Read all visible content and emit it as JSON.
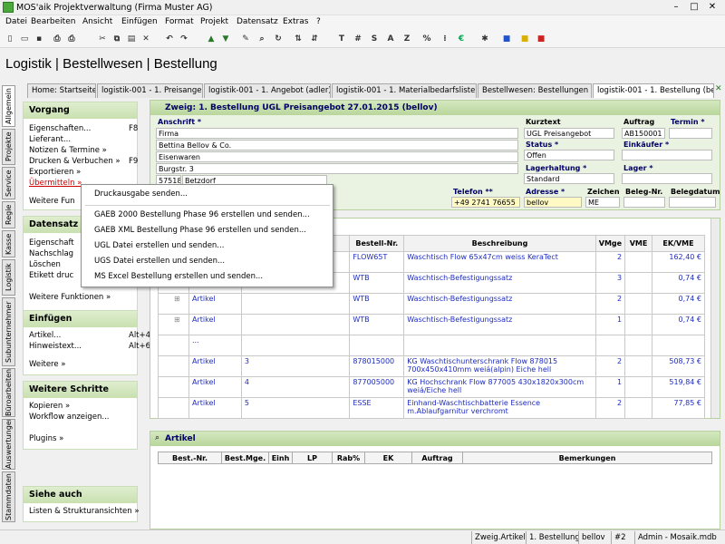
{
  "window": {
    "title": "MOS'aik Projektverwaltung (Firma Muster AG)"
  },
  "menu": [
    "Datei",
    "Bearbeiten",
    "Ansicht",
    "Einfügen",
    "Format",
    "Projekt",
    "Datensatz",
    "Extras",
    "?"
  ],
  "toolbar": {
    "letters": [
      "T",
      "#",
      "S",
      "A",
      "Z",
      "%"
    ]
  },
  "page_title": "Logistik | Bestellwesen | Bestellung",
  "tabs": [
    "Home: Startseite",
    "logistik-001 - 1. Preisangebot",
    "logistik-001 - 1. Angebot (adler)",
    "logistik-001 - 1. Materialbedarfsliste (adler)",
    "Bestellwesen: Bestellungen",
    "logistik-001 - 1. Bestellung (bellov)"
  ],
  "vtabs": [
    "Allgemein",
    "Projekte",
    "Service",
    "Regie",
    "Kasse",
    "Logistik",
    "Subunternehmer",
    "Büroarbeiten",
    "Auswertungen",
    "Stammdaten"
  ],
  "sidebar": {
    "vorgang": {
      "title": "Vorgang",
      "items": [
        {
          "label": "Eigenschaften...",
          "key": "F8"
        },
        {
          "label": "Lieferant..."
        },
        {
          "label": "Notizen & Termine »"
        },
        {
          "label": "Drucken & Verbuchen »",
          "key": "F9"
        },
        {
          "label": "Exportieren »"
        },
        {
          "label": "Übermitteln »"
        }
      ],
      "weitere": "Weitere Fun"
    },
    "datensatz": {
      "title": "Datensatz",
      "items": [
        "Eigenschaft",
        "Nachschlag",
        "Löschen",
        "Etikett druc"
      ],
      "weitere": "Weitere Funktionen »"
    },
    "einfuegen": {
      "title": "Einfügen",
      "items": [
        {
          "label": "Artikel...",
          "key": "Alt+4"
        },
        {
          "label": "Hinweistext...",
          "key": "Alt+6"
        }
      ],
      "weitere": "Weitere »"
    },
    "weitere_schritte": {
      "title": "Weitere Schritte",
      "items": [
        "Kopieren »",
        "Workflow anzeigen..."
      ],
      "plugins": "Plugins »"
    },
    "siehe_auch": {
      "title": "Siehe auch",
      "items": [
        "Listen & Strukturansichten »"
      ]
    }
  },
  "header": {
    "title": "Zweig: 1. Bestellung UGL Preisangebot 27.01.2015 (bellov)",
    "anschrift_label": "Anschrift *",
    "anschrift": [
      "Firma",
      "Bettina Bellov & Co.",
      "Eisenwaren",
      "Burgstr. 3"
    ],
    "plz": "57518",
    "ort": "Betzdorf",
    "telefon_label": "Telefon **",
    "telefon": "+49 2741 76655",
    "kurztext_label": "Kurztext",
    "kurztext": "UGL Preisangebot",
    "auftrag_label": "Auftrag",
    "auftrag": "AB150001",
    "termin_label": "Termin *",
    "status_label": "Status *",
    "status": "Offen",
    "einkaeufer_label": "Einkäufer *",
    "lagerhaltung_label": "Lagerhaltung *",
    "lagerhaltung": "Standard",
    "lager_label": "Lager *",
    "adresse_label": "Adresse *",
    "adresse": "bellov",
    "zeichen_label": "Zeichen",
    "zeichen": "ME",
    "beleg_nr_label": "Beleg-Nr.",
    "belegdatum_label": "Belegdatum"
  },
  "grid": {
    "headers": [
      "",
      "",
      "r *",
      "Bestell-Nr.",
      "Beschreibung",
      "VMge",
      "VME",
      "EK/VME"
    ],
    "rows": [
      {
        "type": "",
        "pos": "",
        "nr": "FLOW65T",
        "desc": "Waschtisch Flow 65x47cm weiss KeraTect",
        "vmge": "2",
        "ek": "162,40 €"
      },
      {
        "type": "",
        "pos": "",
        "nr": "WTB",
        "desc": "Waschtisch-Befestigungssatz",
        "vmge": "3",
        "ek": "0,74 €"
      },
      {
        "type": "Artikel",
        "pos": "",
        "nr": "WTB",
        "desc": "Waschtisch-Befestigungssatz",
        "vmge": "2",
        "ek": "0,74 €"
      },
      {
        "type": "Artikel",
        "pos": "",
        "nr": "WTB",
        "desc": "Waschtisch-Befestigungssatz",
        "vmge": "1",
        "ek": "0,74 €"
      },
      {
        "type": "...",
        "pos": "",
        "nr": "",
        "desc": "",
        "vmge": "",
        "ek": ""
      },
      {
        "type": "Artikel",
        "pos": "3",
        "nr": "878015000",
        "desc": "KG Waschtischunterschrank Flow 878015 700x450x410mm weiá(alpin) Eiche hell",
        "vmge": "2",
        "ek": "508,73 €"
      },
      {
        "type": "Artikel",
        "pos": "4",
        "nr": "877005000",
        "desc": "KG Hochschrank Flow 877005 430x1820x300cm weiá/Eiche hell",
        "vmge": "1",
        "ek": "519,84 €"
      },
      {
        "type": "Artikel",
        "pos": "5",
        "nr": "ESSE",
        "desc": "Einhand-Waschtischbatterie Essence m.Ablaufgarnitur verchromt",
        "vmge": "2",
        "ek": "77,85 €"
      }
    ]
  },
  "artikel_panel": {
    "title": "Artikel",
    "headers": [
      "Best.-Nr.",
      "Best.Mge.",
      "Einh",
      "LP",
      "Rab%",
      "EK",
      "Auftrag",
      "Bemerkungen"
    ]
  },
  "dropdown": [
    "Druckausgabe senden...",
    "GAEB 2000 Bestellung Phase 96 erstellen und senden...",
    "GAEB XML Bestellung Phase 96 erstellen und senden...",
    "UGL Datei erstellen und senden...",
    "UGS Datei erstellen und senden...",
    "MS Excel Bestellung erstellen und senden..."
  ],
  "status": [
    "Zweig.Artikel",
    "1. Bestellung",
    "bellov",
    "#2",
    "Admin - Mosaik.mdb"
  ],
  "colors": {
    "accent_green": "#c9e0b0",
    "link_blue": "#1e2cc0",
    "status_red": "#cc0000"
  }
}
